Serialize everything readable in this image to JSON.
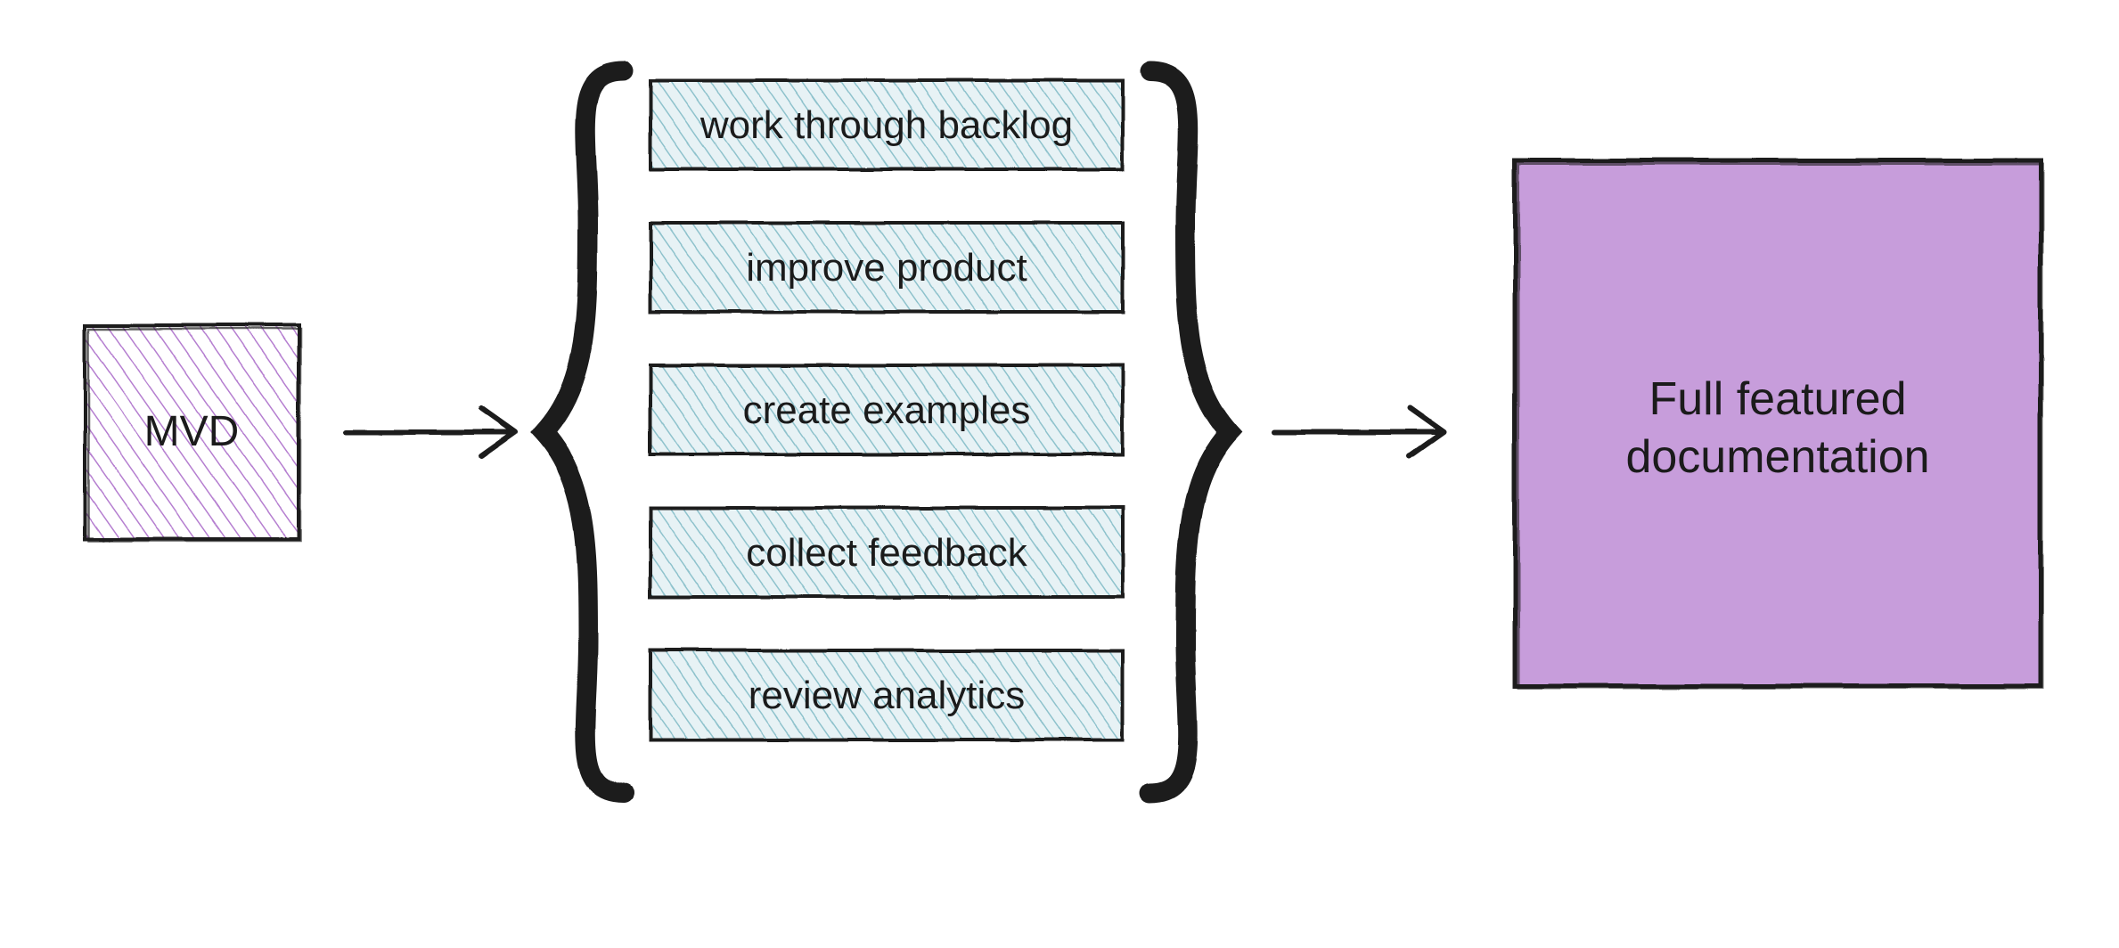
{
  "colors": {
    "purple_fill": "#c79ddb",
    "purple_hatch": "#b57ed0",
    "teal_hatch": "#88bfc9",
    "teal_overlay": "rgba(160,205,214,0.5)",
    "stroke": "#1b1b1b"
  },
  "mvd": {
    "label": "MVD"
  },
  "activities": [
    "work through backlog",
    "improve product",
    "create examples",
    "collect feedback",
    "review analytics"
  ],
  "result": {
    "line1": "Full featured",
    "line2": "documentation"
  }
}
